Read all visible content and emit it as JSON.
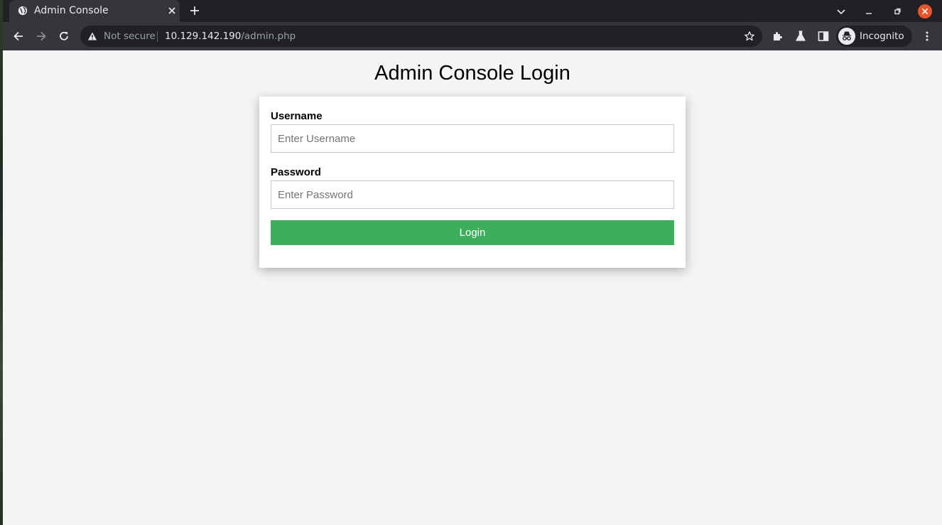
{
  "browser": {
    "tab": {
      "title": "Admin Console",
      "favicon": "globe-icon"
    },
    "address": {
      "security_label": "Not secure",
      "host": "10.129.142.190",
      "path": "/admin.php"
    },
    "profile": {
      "label": "Incognito",
      "icon": "incognito-icon"
    },
    "colors": {
      "tabstrip": "#202124",
      "toolbar": "#35363a",
      "close_button": "#e9542c"
    }
  },
  "page": {
    "title": "Admin Console Login",
    "form": {
      "username_label": "Username",
      "username_placeholder": "Enter Username",
      "username_value": "",
      "password_label": "Password",
      "password_placeholder": "Enter Password",
      "password_value": "",
      "submit_label": "Login"
    },
    "colors": {
      "background": "#f4f4f4",
      "button": "#3cae5c"
    }
  }
}
